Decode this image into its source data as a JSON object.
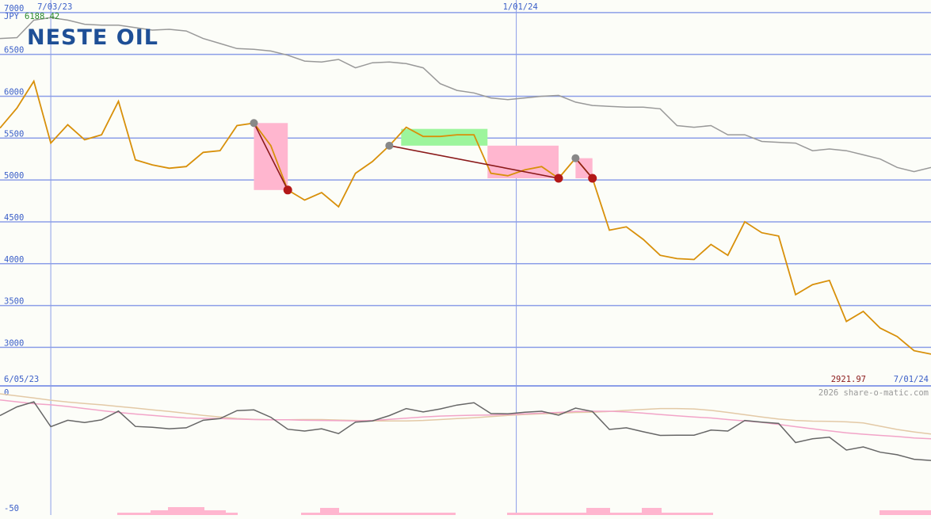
{
  "header": {
    "currency": "JPY",
    "current_value": "6188.42",
    "logo_text": "NESTE OIL",
    "last_value": "2921.97",
    "copyright": "2026 share-o-matic.com"
  },
  "colors": {
    "price_line": "#d8900a",
    "benchmark_line": "#999999",
    "grid": "#8c9ee8",
    "loss_fill": "#ffb6cf",
    "gain_fill": "#9cf59c",
    "trade_line": "#8b1a1a",
    "buy_marker": "#888888",
    "sell_marker": "#b31818",
    "logo": "#1e4f96",
    "osc_line": "#666666",
    "osc_pink": "#f2a4c8",
    "osc_tan": "#e3c9a6",
    "volume": "#ffb6cf"
  },
  "chart_data": [
    {
      "type": "line",
      "y_unit": "JPY",
      "ylim": [
        2540,
        7150
      ],
      "yticks": [
        3000,
        3500,
        4000,
        4500,
        5000,
        5500,
        6000,
        6500,
        7000
      ],
      "x_start_label": "6/05/23",
      "x_end_label": "7/01/24",
      "x_top_labels": [
        "7/03/23",
        "1/01/24"
      ],
      "grid": true,
      "series": [
        {
          "key": "price",
          "values": [
            5620,
            5860,
            6180,
            5440,
            5660,
            5480,
            5540,
            5940,
            5240,
            5180,
            5140,
            5160,
            5330,
            5350,
            5650,
            5680,
            5410,
            4880,
            4760,
            4850,
            4680,
            5080,
            5220,
            5410,
            5630,
            5520,
            5520,
            5540,
            5540,
            5080,
            5050,
            5120,
            5160,
            5020,
            5260,
            5020,
            4400,
            4440,
            4290,
            4100,
            4060,
            4050,
            4230,
            4100,
            4500,
            4370,
            4330,
            3630,
            3750,
            3800,
            3310,
            3430,
            3230,
            3130,
            2960,
            2920
          ]
        },
        {
          "key": "benchmark",
          "values": [
            6690,
            6700,
            6910,
            6940,
            6910,
            6860,
            6850,
            6850,
            6820,
            6790,
            6800,
            6780,
            6690,
            6630,
            6570,
            6560,
            6540,
            6490,
            6420,
            6410,
            6440,
            6340,
            6400,
            6410,
            6390,
            6340,
            6150,
            6070,
            6040,
            5980,
            5960,
            5980,
            6000,
            6010,
            5930,
            5890,
            5880,
            5870,
            5870,
            5850,
            5650,
            5630,
            5650,
            5540,
            5540,
            5460,
            5450,
            5440,
            5350,
            5370,
            5350,
            5300,
            5250,
            5150,
            5100,
            5150
          ]
        }
      ],
      "trades": [
        {
          "entry_index": 15,
          "exit_index": 17,
          "result": "loss"
        },
        {
          "entry_index": 23,
          "exit_index": 33,
          "result": "mixed"
        },
        {
          "entry_index": 34,
          "exit_index": 35,
          "result": "loss"
        }
      ]
    },
    {
      "type": "line",
      "ylim": [
        -50,
        0
      ],
      "yticks": [
        0,
        -50
      ],
      "series": [
        {
          "key": "oscillator",
          "values": [
            -9.5,
            -5.7,
            -3.5,
            -14.3,
            -11.5,
            -12.5,
            -11.3,
            -7.5,
            -14.2,
            -14.6,
            -15.2,
            -14.8,
            -11.5,
            -10.8,
            -7.3,
            -7.0,
            -10.2,
            -15.4,
            -16.2,
            -15.2,
            -17.3,
            -12.3,
            -11.8,
            -9.5,
            -6.4,
            -7.9,
            -6.6,
            -4.9,
            -3.9,
            -8.6,
            -8.7,
            -8.0,
            -7.6,
            -9.3,
            -6.2,
            -7.7,
            -15.5,
            -14.8,
            -16.5,
            -18.1,
            -18.0,
            -18.0,
            -15.8,
            -16.2,
            -11.6,
            -12.3,
            -12.9,
            -21.2,
            -19.6,
            -18.9,
            -24.5,
            -23.1,
            -25.4,
            -26.5,
            -28.5,
            -29.0
          ]
        },
        {
          "key": "ma_fast",
          "values": [
            -2.7,
            -3.5,
            -4.3,
            -4.8,
            -5.5,
            -6.4,
            -7.3,
            -8.1,
            -8.8,
            -9.4,
            -10.0,
            -10.5,
            -10.7,
            -10.8,
            -11.0,
            -11.2,
            -11.3,
            -11.3,
            -11.5,
            -11.6,
            -11.7,
            -11.8,
            -11.6,
            -11.1,
            -10.6,
            -10.1,
            -9.7,
            -9.5,
            -9.3,
            -9.2,
            -9.0,
            -8.7,
            -8.4,
            -8.1,
            -7.7,
            -7.6,
            -7.6,
            -7.9,
            -8.4,
            -9.0,
            -9.6,
            -10.1,
            -10.5,
            -11.2,
            -11.8,
            -12.4,
            -13.3,
            -14.3,
            -15.2,
            -16.1,
            -17.0,
            -17.6,
            -18.1,
            -18.6,
            -19.2,
            -19.6
          ]
        },
        {
          "key": "ma_slow",
          "values": [
            0.0,
            -0.9,
            -1.8,
            -2.8,
            -3.6,
            -4.2,
            -4.8,
            -5.5,
            -6.2,
            -7.0,
            -7.7,
            -8.5,
            -9.4,
            -10.1,
            -10.8,
            -11.1,
            -11.3,
            -11.3,
            -11.2,
            -11.2,
            -11.4,
            -11.6,
            -11.8,
            -11.8,
            -11.8,
            -11.6,
            -11.2,
            -10.8,
            -10.4,
            -9.9,
            -9.4,
            -9.0,
            -8.7,
            -8.5,
            -8.1,
            -8.0,
            -7.7,
            -7.2,
            -6.8,
            -6.4,
            -6.4,
            -6.6,
            -7.2,
            -8.1,
            -9.1,
            -10.1,
            -11.0,
            -11.6,
            -11.9,
            -12.0,
            -12.2,
            -12.7,
            -14.1,
            -15.5,
            -16.6,
            -17.5
          ]
        }
      ]
    }
  ]
}
